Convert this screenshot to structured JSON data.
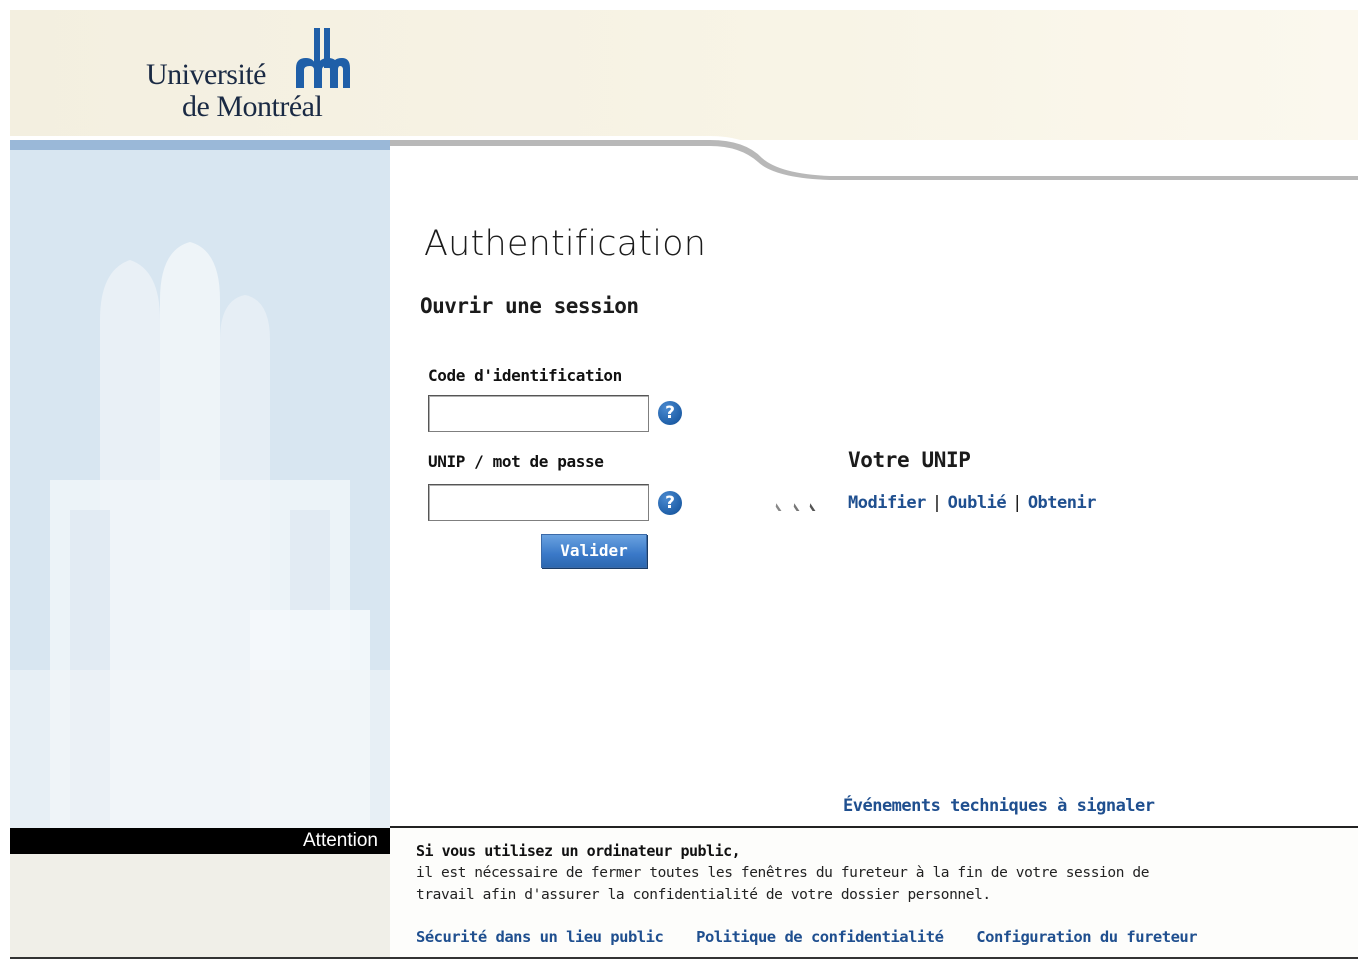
{
  "header": {
    "logo_line1": "Université",
    "logo_line2": "de Montréal",
    "logo_icon": "udem-logo-mark"
  },
  "main": {
    "title": "Authentification",
    "subtitle": "Ouvrir une session",
    "code_label": "Code d'identification",
    "code_value": "",
    "unip_label": "UNIP / mot de passe",
    "unip_value": "",
    "help_glyph": "?",
    "submit_label": "Valider"
  },
  "unip_panel": {
    "heading": "Votre UNIP",
    "links": [
      "Modifier",
      "Oublié",
      "Obtenir"
    ],
    "separator": "|"
  },
  "events_link": "Événements techniques à signaler",
  "footer": {
    "attention_label": "Attention",
    "warning_bold": "Si vous utilisez un ordinateur public,",
    "warning_text": "il est nécessaire de fermer toutes les fenêtres du fureteur à la fin de votre session de travail afin d'assurer la confidentialité de votre dossier personnel.",
    "links": [
      "Sécurité dans un lieu public",
      "Politique de confidentialité",
      "Configuration du fureteur"
    ]
  },
  "colors": {
    "link": "#1f4f8f",
    "button": "#3a79c8",
    "header_bg": "#f5f1e3",
    "help_icon": "#1f5fa8"
  }
}
